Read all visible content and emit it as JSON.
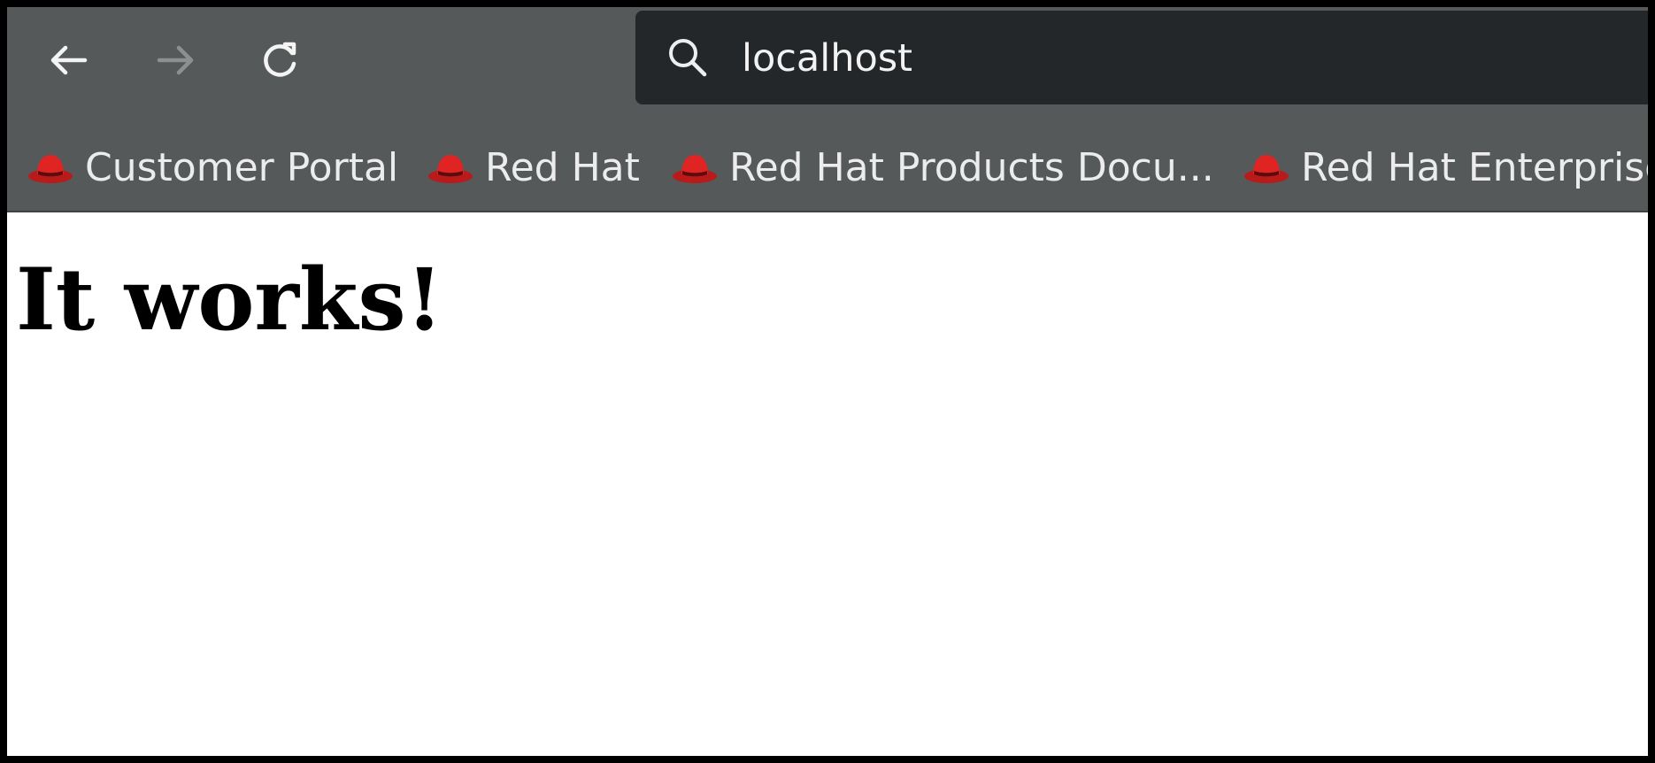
{
  "browser": {
    "nav": {
      "back": "back-arrow-icon",
      "forward": "forward-arrow-icon",
      "reload": "reload-icon"
    },
    "url_bar": {
      "icon": "search-icon",
      "value": "localhost"
    },
    "bookmarks": [
      {
        "label": "Customer Portal",
        "icon": "red-hat-icon"
      },
      {
        "label": "Red Hat",
        "icon": "red-hat-icon"
      },
      {
        "label": "Red Hat Products Docu...",
        "icon": "red-hat-icon"
      },
      {
        "label": "Red Hat Enterprise",
        "icon": "red-hat-icon"
      }
    ]
  },
  "page": {
    "heading": "It works!"
  },
  "colors": {
    "toolbar": "#55595a",
    "url_bar": "#232729",
    "bookmark_icon": "#d6201f",
    "content_bg": "#ffffff"
  }
}
